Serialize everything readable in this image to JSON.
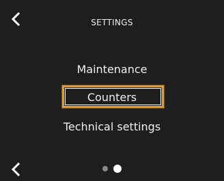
{
  "header": {
    "title": "SETTINGS",
    "back_icon": "chevron-left-icon"
  },
  "menu": {
    "items": [
      {
        "label": "Maintenance",
        "selected": false
      },
      {
        "label": "Counters",
        "selected": true
      },
      {
        "label": "Technical settings",
        "selected": false
      }
    ],
    "selection_color": "#e39b34"
  },
  "footer": {
    "back_icon": "chevron-left-icon",
    "pagination": {
      "pages": 2,
      "current": 2
    }
  },
  "colors": {
    "background": "#1e1e1e",
    "text": "#ffffff",
    "inactive_dot": "#8a8a8a"
  }
}
